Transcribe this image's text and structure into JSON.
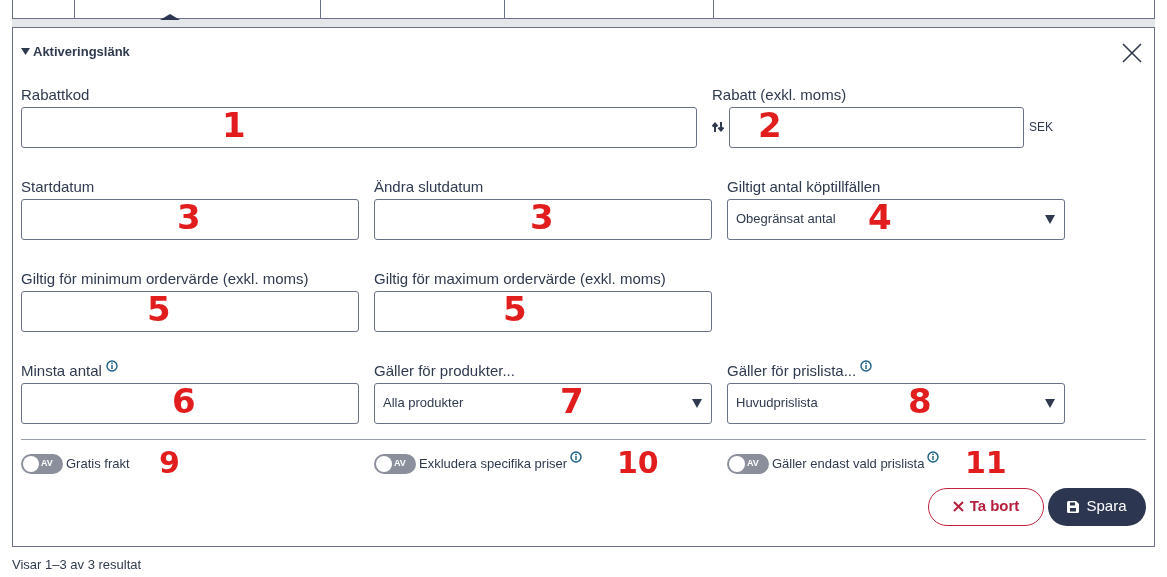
{
  "section": {
    "title": "Aktiveringslänk",
    "expanded": true
  },
  "rows": [
    [
      {
        "kind": "text",
        "label": "Rabattkod",
        "annotation": "1"
      },
      {
        "kind": "amount",
        "label": "Rabatt (exkl. moms)",
        "unit": "SEK",
        "annotation": "2"
      }
    ],
    [
      {
        "kind": "text",
        "label": "Startdatum",
        "annotation": "3"
      },
      {
        "kind": "text",
        "label": "Ändra slutdatum",
        "annotation": "3"
      },
      {
        "kind": "select",
        "label": "Giltigt antal köptillfällen",
        "value": "Obegränsat antal",
        "annotation": "4"
      }
    ],
    [
      {
        "kind": "text",
        "label": "Giltig för minimum ordervärde (exkl. moms)",
        "annotation": "5"
      },
      {
        "kind": "text",
        "label": "Giltig för maximum ordervärde (exkl. moms)",
        "annotation": "5"
      }
    ],
    [
      {
        "kind": "text",
        "label": "Minsta antal",
        "info": true,
        "annotation": "6"
      },
      {
        "kind": "select",
        "label": "Gäller för produkter...",
        "value": "Alla produkter",
        "annotation": "7"
      },
      {
        "kind": "select",
        "label": "Gäller för prislista...",
        "info": true,
        "value": "Huvudprislista",
        "annotation": "8"
      }
    ]
  ],
  "toggles": [
    {
      "label": "Gratis frakt",
      "on": false,
      "state_label": "AV",
      "annotation": "9"
    },
    {
      "label": "Exkludera specifika priser",
      "on": false,
      "state_label": "AV",
      "info": true,
      "annotation": "10"
    },
    {
      "label": "Gäller endast vald prislista",
      "on": false,
      "state_label": "AV",
      "info": true,
      "annotation": "11"
    }
  ],
  "buttons": [
    {
      "kind": "delete",
      "label": "Ta bort"
    },
    {
      "kind": "save",
      "label": "Spara"
    }
  ],
  "footer": "Visar 1–3 av 3 resultat"
}
